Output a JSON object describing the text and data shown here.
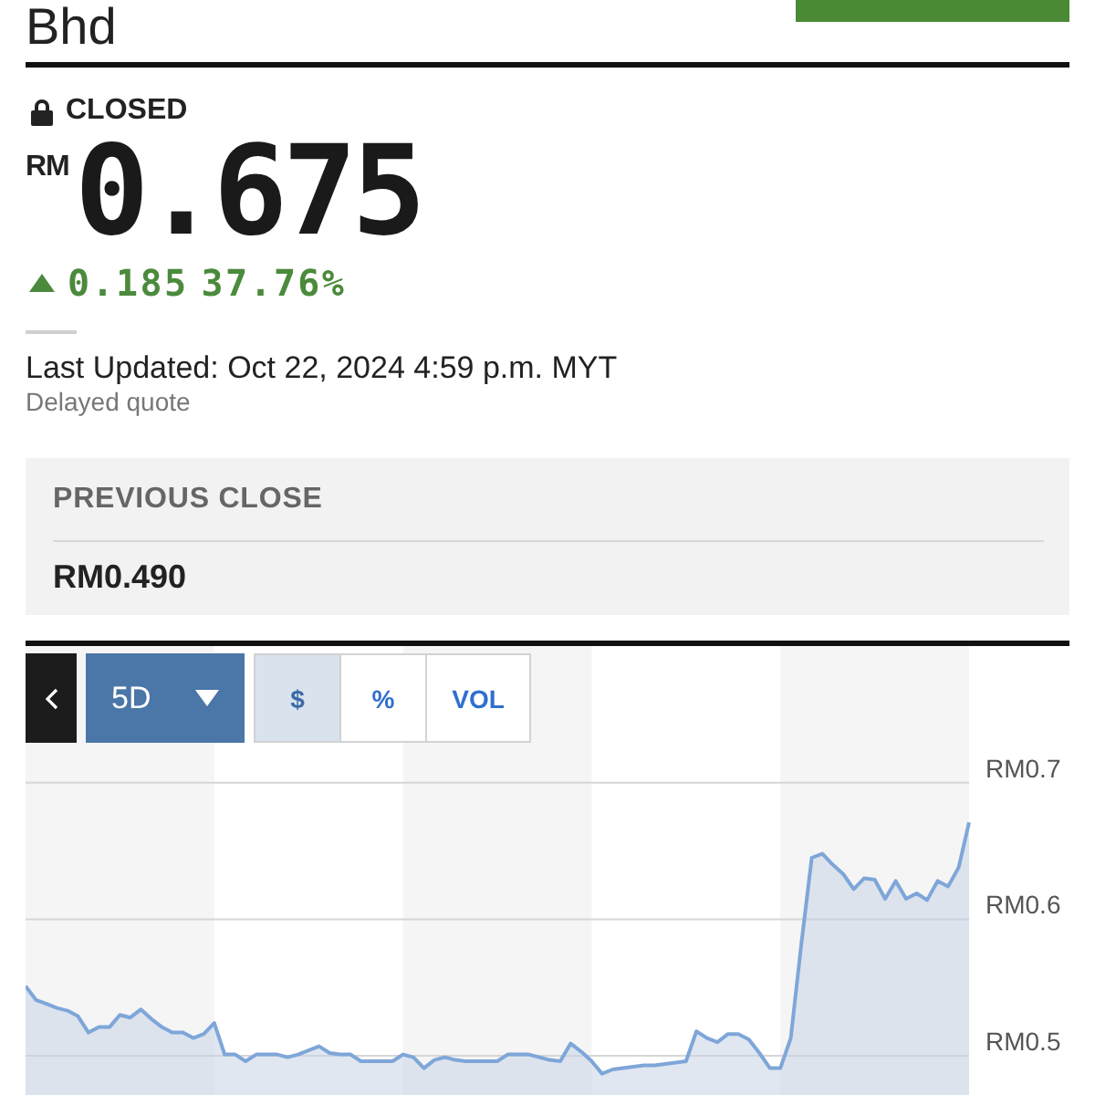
{
  "header": {
    "title": "Bhd"
  },
  "quote": {
    "status": "CLOSED",
    "currency": "RM",
    "price": "0.675",
    "change": "0.185",
    "change_percent": "37.76%",
    "last_updated": "Last Updated: Oct 22, 2024 4:59 p.m. MYT",
    "note": "Delayed quote"
  },
  "previous_close": {
    "label": "PREVIOUS CLOSE",
    "value": "RM0.490"
  },
  "chart": {
    "range": "5D",
    "views": [
      {
        "label": "$",
        "selected": true
      },
      {
        "label": "%",
        "selected": false
      },
      {
        "label": "VOL",
        "selected": false
      }
    ],
    "axis_labels": [
      "RM0.7",
      "RM0.6",
      "RM0.5"
    ]
  }
}
